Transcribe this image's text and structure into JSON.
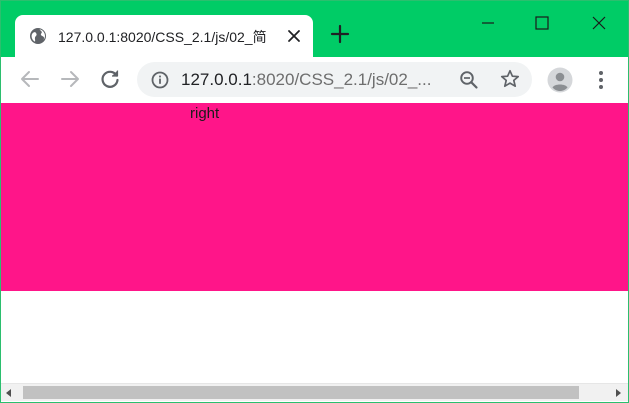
{
  "colors": {
    "titlebar": "#00cc66",
    "page_block": "#ff1589",
    "icon_gray": "#5f6368",
    "disabled_gray": "#b6b8bb"
  },
  "tab": {
    "title": "127.0.0.1:8020/CSS_2.1/js/02_简",
    "icon": "globe-icon"
  },
  "omnibox": {
    "url_host": "127.0.0.1",
    "url_rest": ":8020/CSS_2.1/js/02_..."
  },
  "page": {
    "block_text": "right"
  },
  "scrollbar": {
    "horizontal_position": 0
  }
}
